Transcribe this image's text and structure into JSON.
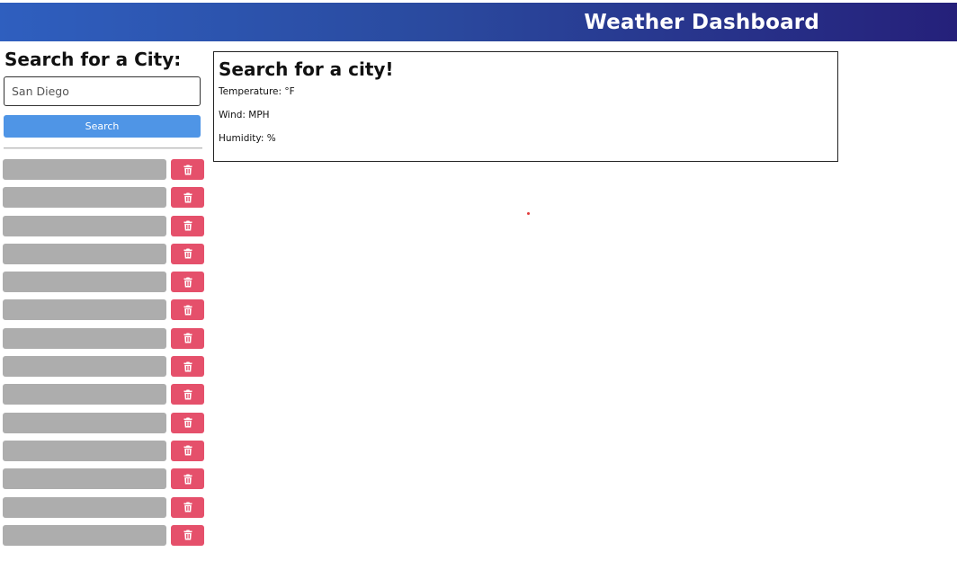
{
  "header": {
    "title": "Weather Dashboard"
  },
  "sidebar": {
    "heading": "Search for a City:",
    "search_input_value": "San Diego",
    "search_button_label": "Search",
    "history_count": 14
  },
  "card": {
    "title": "Search for a city!",
    "temperature": "Temperature: °F",
    "wind": "Wind: MPH",
    "humidity": "Humidity: %"
  },
  "colors": {
    "header_gradient_start": "#2f5fbf",
    "header_gradient_end": "#25207a",
    "search_button": "#4f95e6",
    "history_button": "#adadad",
    "delete_button": "#e5506b"
  },
  "icons": {
    "delete": "trash-icon"
  }
}
